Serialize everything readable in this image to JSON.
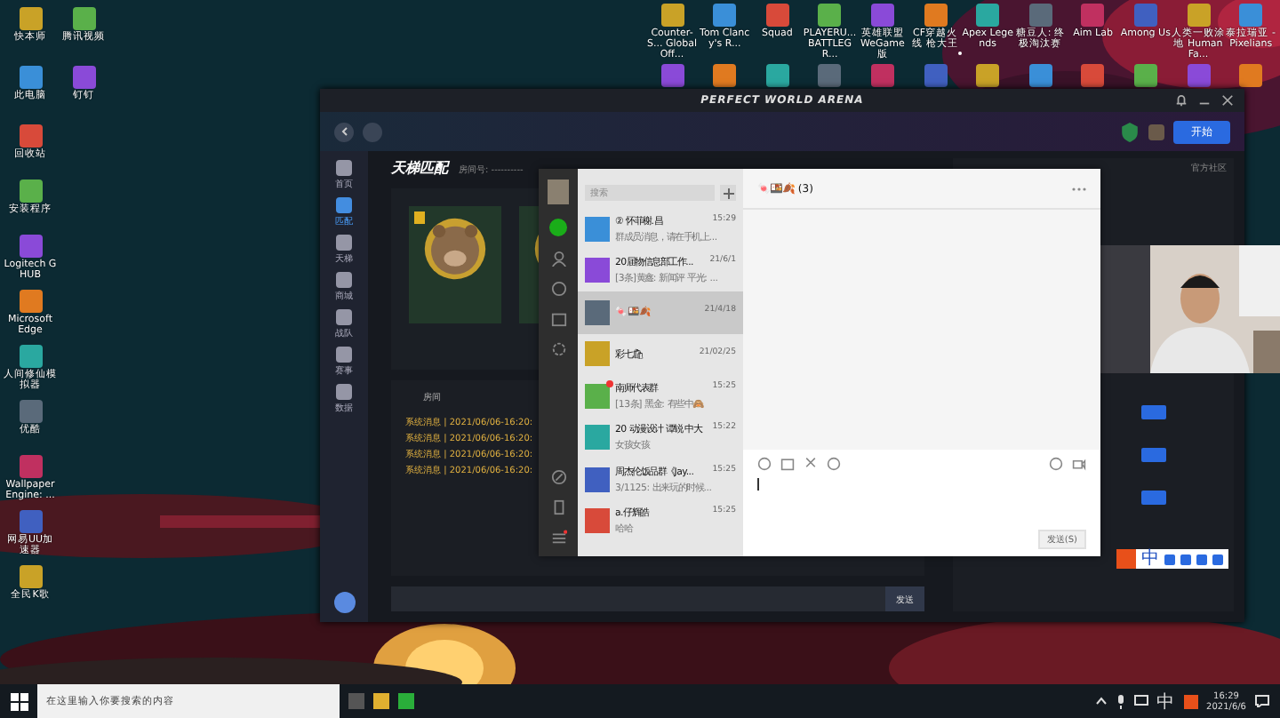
{
  "desktop": {
    "left_icons": [
      [
        {
          "label": "快本师"
        },
        {
          "label": "腾讯视频"
        }
      ],
      [
        {
          "label": "此电脑"
        },
        {
          "label": "钉钉"
        }
      ],
      [
        {
          "label": "回收站"
        }
      ],
      [
        {
          "label": "安装程序"
        }
      ],
      [
        {
          "label": "Logitech G HUB"
        }
      ],
      [
        {
          "label": "Microsoft Edge"
        }
      ],
      [
        {
          "label": "人间修仙模拟器"
        }
      ],
      [
        {
          "label": "优酷"
        }
      ],
      [
        {
          "label": "Wallpaper Engine: ..."
        }
      ],
      [
        {
          "label": "网易UU加速器"
        }
      ],
      [
        {
          "label": "全民K歌"
        }
      ]
    ],
    "top_icons": [
      [
        {
          "label": "Counter-S... Global Off..."
        },
        {
          "label": "Tom Clancy's R..."
        },
        {
          "label": "Squad"
        },
        {
          "label": "PLAYERU... BATTLEGR..."
        },
        {
          "label": "英雄联盟 WeGame版"
        },
        {
          "label": "CF穿越火线 枪大王"
        },
        {
          "label": "Apex Legends"
        },
        {
          "label": "糖豆人: 终极淘汰赛"
        },
        {
          "label": "Aim Lab"
        },
        {
          "label": "Among Us"
        },
        {
          "label": "人类一败涂地 Human Fa..."
        },
        {
          "label": "泰拉瑞亚 - Pixelians"
        }
      ],
      [
        {
          "kind": "app"
        },
        {
          "kind": "app"
        },
        {
          "kind": "app"
        },
        {
          "kind": "app"
        },
        {
          "kind": "app"
        },
        {
          "kind": "app"
        },
        {
          "kind": "app"
        },
        {
          "kind": "app"
        },
        {
          "kind": "app"
        },
        {
          "kind": "app"
        },
        {
          "kind": "app"
        },
        {
          "kind": "app"
        }
      ]
    ]
  },
  "game_window": {
    "title": "PERFECT WORLD ARENA",
    "start_button": "开始",
    "community": "官方社区",
    "nav": [
      {
        "label": "首页",
        "selected": false
      },
      {
        "label": "匹配",
        "selected": true
      },
      {
        "label": "天梯",
        "selected": false
      },
      {
        "label": "商城",
        "selected": false
      },
      {
        "label": "战队",
        "selected": false
      },
      {
        "label": "赛事",
        "selected": false
      },
      {
        "label": "数据",
        "selected": false
      }
    ],
    "page_title": "天梯匹配",
    "room_label": "房间号:",
    "room_value": "----------",
    "room_tab": "房间",
    "messages": [
      "系统消息 | 2021/06/06-16:20:",
      "系统消息 | 2021/06/06-16:20:",
      "系统消息 | 2021/06/06-16:20:",
      "系统消息 | 2021/06/06-16:20:"
    ],
    "send_button": "发送"
  },
  "chat_window": {
    "search": {
      "placeholder": "搜索"
    },
    "header": "🍬🍱🍂 (3)",
    "send_button": "发送(S)",
    "chats": [
      {
        "name": "② 怀菲榭.昌",
        "preview": "群成员消息，请在手机上...",
        "time": "15:29",
        "selected": false,
        "unread": false
      },
      {
        "name": "20届物信息部工作...",
        "preview": "[3条]黄鑫: 新闻评 平光: ...",
        "time": "21/6/1",
        "selected": false,
        "unread": false
      },
      {
        "name": "🍬🍱🍂",
        "time": "21/4/18",
        "selected": true,
        "unread": false
      },
      {
        "name": "彩七🛍",
        "time": "21/02/25",
        "selected": false,
        "unread": false
      },
      {
        "name": "南师代表群",
        "preview": "[13条] 黑金: 有些中🙈",
        "time": "15:25",
        "selected": false,
        "unread": true
      },
      {
        "name": "20 动漫设计 谭锐 中大",
        "preview": "女孩女孩",
        "time": "15:22",
        "selected": false,
        "unread": false
      },
      {
        "name": "周杰伦饭品群《Jay...",
        "preview": "3/1125: 出来玩的时候...",
        "time": "15:25",
        "selected": false,
        "unread": false
      },
      {
        "name": "a.仔辉皓",
        "preview": "哈哈",
        "time": "15:25",
        "selected": false,
        "unread": false
      }
    ]
  },
  "ime_bar": {
    "mode": "中"
  },
  "taskbar": {
    "search": {
      "placeholder": "在这里输入你要搜索的内容"
    },
    "ime": "中",
    "time": "16:29",
    "date": "2021/6/6"
  }
}
